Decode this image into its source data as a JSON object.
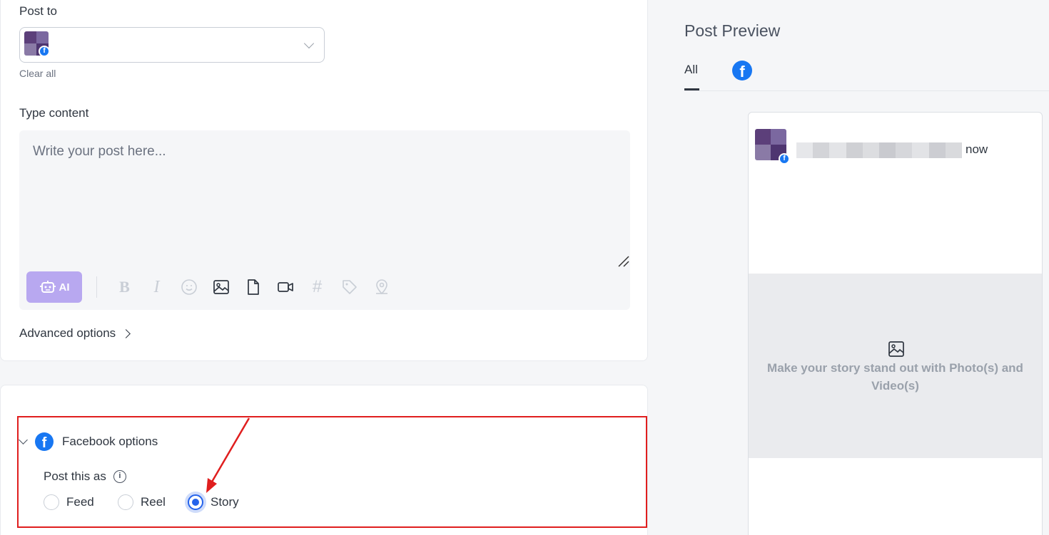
{
  "post_to": {
    "label": "Post to",
    "clear_all": "Clear all"
  },
  "content": {
    "label": "Type content",
    "placeholder": "Write your post here..."
  },
  "toolbar": {
    "ai_label": "AI",
    "bold": "B",
    "italic": "I",
    "hashtag": "#",
    "icons": [
      "robot-icon",
      "bold-icon",
      "italic-icon",
      "emoji-icon",
      "image-icon",
      "file-icon",
      "video-icon",
      "hashtag-icon",
      "tag-icon",
      "location-icon"
    ]
  },
  "advanced_options": "Advanced options",
  "facebook_options": {
    "title": "Facebook options",
    "post_as_label": "Post this as",
    "options": [
      {
        "label": "Feed",
        "selected": false
      },
      {
        "label": "Reel",
        "selected": false
      },
      {
        "label": "Story",
        "selected": true
      }
    ]
  },
  "preview": {
    "title": "Post Preview",
    "tabs": [
      "All",
      "facebook"
    ],
    "active_tab": "All",
    "time": "now",
    "media_placeholder": "Make your story stand out with Photo(s) and Video(s)"
  },
  "colors": {
    "facebook_blue": "#1877f2",
    "ai_button": "#b8a8f0",
    "radio_selected": "#2563eb",
    "highlight_red": "#e01e1e"
  }
}
